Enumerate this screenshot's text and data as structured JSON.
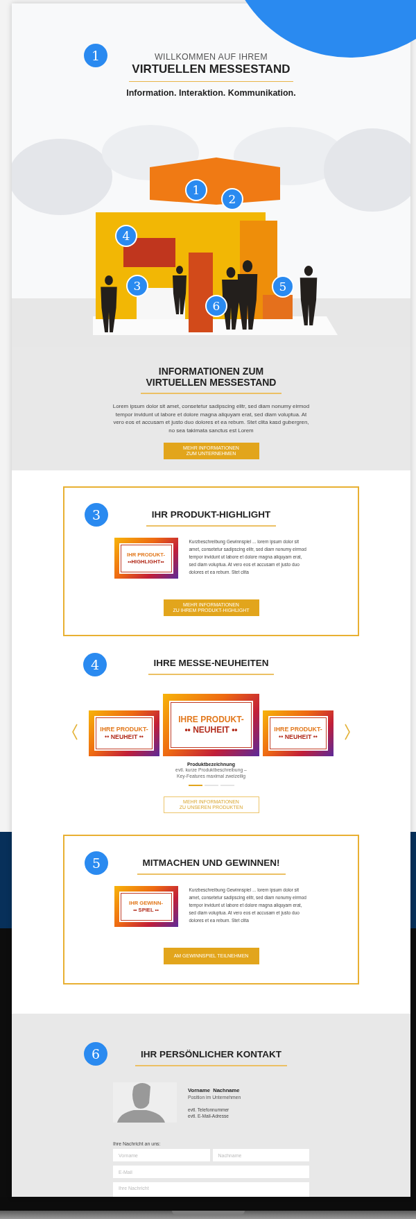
{
  "hero": {
    "badge": "1",
    "kicker": "WILLKOMMEN AUF IHREM",
    "title": "VIRTUELLEN MESSESTAND",
    "tagline": "Information. Interaktion. Kommunikation.",
    "markers": [
      "1",
      "2",
      "3",
      "4",
      "5",
      "6"
    ]
  },
  "info": {
    "title_lines": [
      "INFORMATIONEN ZUM",
      "VIRTUELLEN MESSESTAND"
    ],
    "text": "Lorem ipsum dolor sit amet, consetetur sadipscing elitr, sed diam nonumy eirmod tempor invidunt ut labore et dolore magna aliquyam erat, sed diam voluptua. At vero eos et accusam et justo duo dolores et ea rebum. Stet clita kasd gubergren, no sea takimata sanctus est Lorem",
    "button": {
      "kind": "filled",
      "lines": [
        "MEHR INFORMATIONEN",
        "ZUM UNTERNEHMEN"
      ]
    }
  },
  "highlight": {
    "badge": "3",
    "title": "IHR PRODUKT-HIGHLIGHT",
    "banner": [
      "IHR PRODUKT-",
      "••HIGHLIGHT••"
    ],
    "text": "Kurzbeschreibung Gewinnspiel ... lorem ipsum dolor sit amet, consetetur sadipscing elitr, sed diam nonumy eirmod tempor invidunt ut labore et dolore magna aliquyam erat, sed diam voluptua. At vero eos et accusam et justo duo dolores et ea rebum. Stet clita",
    "button": {
      "kind": "filled",
      "lines": [
        "MEHR INFORMATIONEN",
        "ZU IHREM PRODUKT-HIGHLIGHT"
      ]
    }
  },
  "news": {
    "badge": "4",
    "title": "IHRE MESSE-NEUHEITEN",
    "slides": [
      {
        "lines": [
          "IHRE PRODUKT-",
          "•• NEUHEIT ••"
        ],
        "selected": false
      },
      {
        "lines": [
          "IHRE PRODUKT-",
          "•• NEUHEIT ••"
        ],
        "selected": true
      },
      {
        "lines": [
          "IHRE PRODUKT-",
          "•• NEUHEIT ••"
        ],
        "selected": false
      }
    ],
    "caption": {
      "name": "Produktbezeichnung",
      "lines": [
        "evtl. kurze Produktbeschreibung –",
        "Key-Features maximal zweizeilig"
      ]
    },
    "dots": [
      {
        "selected": true
      },
      {
        "selected": false
      },
      {
        "selected": false
      }
    ],
    "button": {
      "kind": "outline",
      "lines": [
        "MEHR INFORMATIONEN",
        "ZU UNSEREN PRODUKTEN"
      ]
    }
  },
  "contest": {
    "badge": "5",
    "title": "MITMACHEN UND GEWINNEN!",
    "banner": [
      "IHR GEWINN-",
      "•• SPIEL ••"
    ],
    "text": "Kurzbeschreibung Gewinnspiel ... lorem ipsum dolor sit amet, consetetur sadipscing elitr, sed diam nonumy eirmod tempor invidunt ut labore et dolore magna aliquyam erat, sed diam voluptua. At vero eos et accusam et justo duo dolores et ea rebum. Stet clita",
    "button": {
      "kind": "filled",
      "lines": [
        "AM GEWINNSPIEL TEILNEHMEN"
      ]
    }
  },
  "contact": {
    "badge": "6",
    "title": "IHR PERSÖNLICHER KONTAKT",
    "name": "Vorname  Nachname",
    "position": "Position im Unternehmen",
    "phone": "evtl. Telefonnummer",
    "email": "evtl. E-Mail-Adresse",
    "form_label": "Ihre Nachricht an uns:",
    "fields": [
      {
        "kind": "half",
        "placeholder": "Vorname"
      },
      {
        "kind": "half",
        "placeholder": "Nachname"
      },
      {
        "kind": "full",
        "placeholder": "E-Mail"
      },
      {
        "kind": "area",
        "placeholder": "Ihre Nachricht"
      }
    ]
  }
}
